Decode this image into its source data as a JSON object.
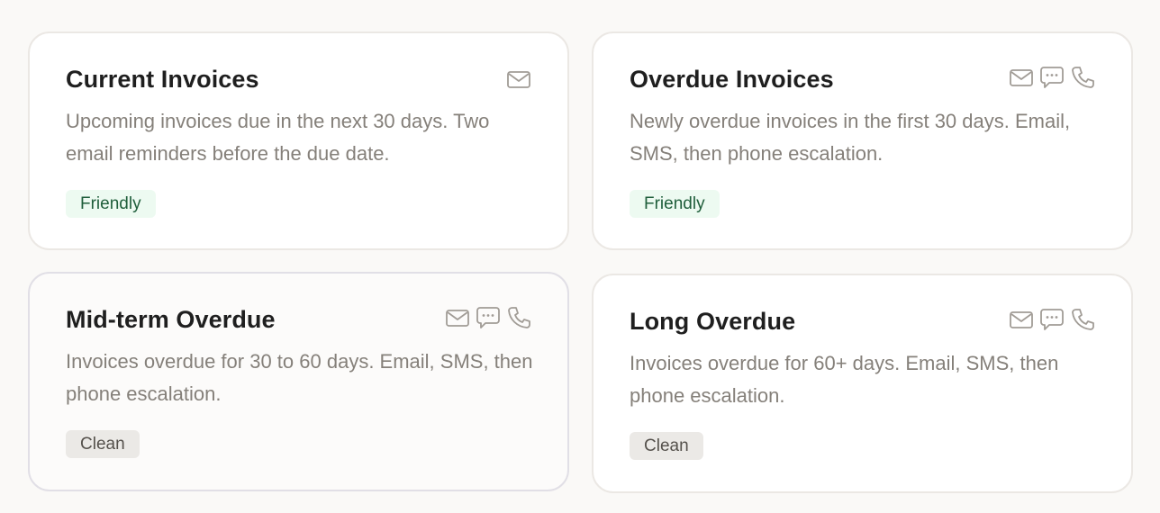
{
  "cards": [
    {
      "title": "Current Invoices",
      "description": "Upcoming invoices due in the next 30 days. Two email reminders before the due date.",
      "channels": [
        "mail-icon"
      ],
      "badge": "Friendly"
    },
    {
      "title": "Overdue Invoices",
      "description": "Newly overdue invoices in the first 30 days. Email, SMS, then phone escalation.",
      "channels": [
        "mail-icon",
        "chat-icon",
        "phone-icon"
      ],
      "badge": "Friendly"
    },
    {
      "title": "Mid-term Overdue",
      "description": "Invoices overdue for 30 to 60 days. Email, SMS, then phone escalation.",
      "channels": [
        "mail-icon",
        "chat-icon",
        "phone-icon"
      ],
      "badge": "Clean"
    },
    {
      "title": "Long Overdue",
      "description": "Invoices overdue for 60+ days. Email, SMS, then phone escalation.",
      "channels": [
        "mail-icon",
        "chat-icon",
        "phone-icon"
      ],
      "badge": "Clean"
    }
  ],
  "colors": {
    "page_background": "#faf9f7",
    "card_border": "#ebe8e4",
    "title": "#1f1f1f",
    "description": "#85807a",
    "icon": "#a19c96",
    "friendly_badge_bg": "#edfaf1",
    "friendly_badge_text": "#1f5e3b",
    "clean_badge_bg": "#ebe9e6",
    "clean_badge_text": "#55514c"
  }
}
